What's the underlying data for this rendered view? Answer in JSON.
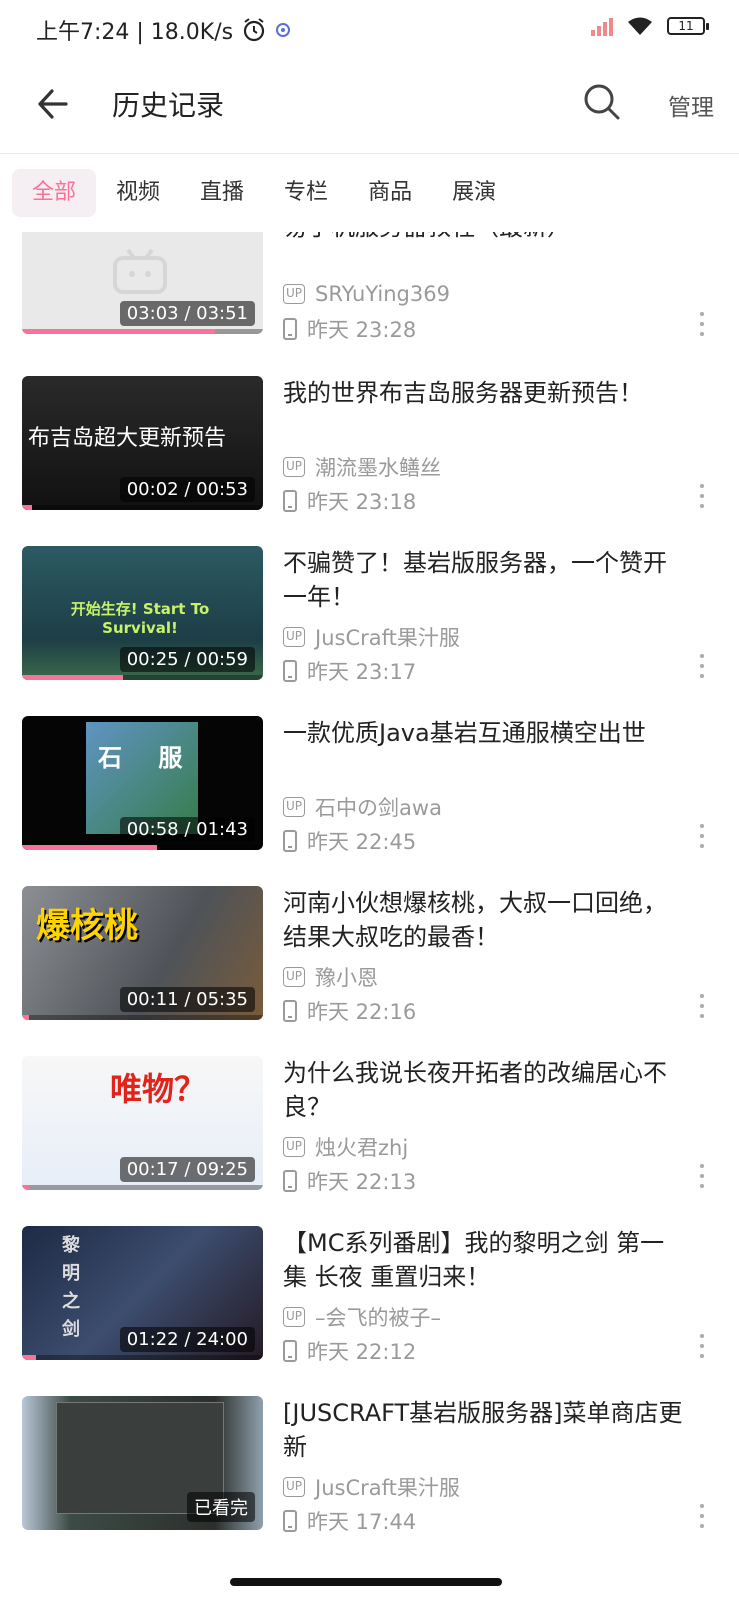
{
  "status_bar": {
    "time_speed": "上午7:24 | 18.0K/s",
    "battery": "11"
  },
  "header": {
    "title": "历史记录",
    "manage": "管理"
  },
  "tabs": [
    "全部",
    "视频",
    "直播",
    "专栏",
    "商品",
    "展演"
  ],
  "items": [
    {
      "title": "MCBE服务器搭建教程 | 易手机服务器教程（最新）",
      "title_visible": "易手机服务器教程（最新）",
      "author": "SRYuYing369",
      "time": "昨天 23:28",
      "duration": "03:03 / 03:51",
      "progress": 0.8,
      "thumb_text": ""
    },
    {
      "title": "我的世界布吉岛服务器更新预告！",
      "author": "潮流墨水鳝丝",
      "time": "昨天 23:18",
      "duration": "00:02 / 00:53",
      "progress": 0.04,
      "thumb_text": "布吉岛超大更新预告"
    },
    {
      "title": "不骗赞了！基岩版服务器，一个赞开一年！",
      "author": "JusCraft果汁服",
      "time": "昨天 23:17",
      "duration": "00:25 / 00:59",
      "progress": 0.42,
      "thumb_text": "开始生存! Start To Survival!"
    },
    {
      "title": "一款优质Java基岩互通服横空出世",
      "author": "石中の剑awa",
      "time": "昨天 22:45",
      "duration": "00:58 / 01:43",
      "progress": 0.56,
      "thumb_text": "石 服"
    },
    {
      "title": "河南小伙想爆核桃，大叔一口回绝，结果大叔吃的最香！",
      "author": "豫小恩",
      "time": "昨天 22:16",
      "duration": "00:11 / 05:35",
      "progress": 0.03,
      "thumb_text": "爆核桃"
    },
    {
      "title": "为什么我说长夜开拓者的改编居心不良？",
      "author": "烛火君zhj",
      "time": "昨天 22:13",
      "duration": "00:17 / 09:25",
      "progress": 0.03,
      "thumb_text": "唯物？"
    },
    {
      "title": "【MC系列番剧】我的黎明之剑 第一集 长夜 重置归来！",
      "author": "–会飞的被子–",
      "time": "昨天 22:12",
      "duration": "01:22 / 24:00",
      "progress": 0.06,
      "thumb_text": "黎 明 之 剑"
    },
    {
      "title": "[JUSCRAFT基岩版服务器]菜单商店更新",
      "author": "JusCraft果汁服",
      "time": "昨天 17:44",
      "duration": "已看完",
      "progress": 1.0,
      "thumb_text": ""
    }
  ],
  "colors": {
    "accent": "#fb7299"
  }
}
